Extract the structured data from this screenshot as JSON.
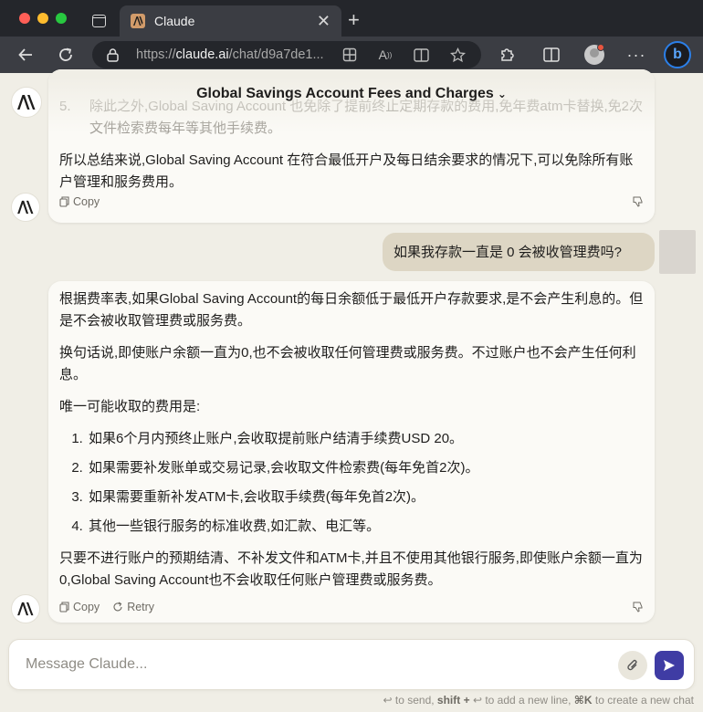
{
  "browser": {
    "tab_title": "Claude",
    "url_domain": "claude.ai",
    "url_prefix": "https://",
    "url_path": "/chat/d9a7de1..."
  },
  "conversation": {
    "title": "Global Savings Account Fees and Charges",
    "prev_assistant": {
      "faded_item_number": "5.",
      "faded_item_text": "除此之外,Global Saving Account 也免除了提前终止定期存款的费用,免年费atm卡替换,免2次文件检索费每年等其他手续费。",
      "summary": "所以总结来说,Global Saving Account 在符合最低开户及每日结余要求的情况下,可以免除所有账户管理和服务费用。",
      "copy_label": "Copy"
    },
    "user_message": "如果我存款一直是 0 会被收管理费吗?",
    "assistant": {
      "paragraphs": [
        "根据费率表,如果Global Saving Account的每日余额低于最低开户存款要求,是不会产生利息的。但是不会被收取管理费或服务费。",
        "换句话说,即使账户余额一直为0,也不会被收取任何管理费或服务费。不过账户也不会产生任何利息。",
        "唯一可能收取的费用是:"
      ],
      "list": [
        "如果6个月内预终止账户,会收取提前账户结清手续费USD 20。",
        "如果需要补发账单或交易记录,会收取文件检索费(每年免首2次)。",
        "如果需要重新补发ATM卡,会收取手续费(每年免首2次)。",
        "其他一些银行服务的标准收费,如汇款、电汇等。"
      ],
      "closing": "只要不进行账户的预期结清、不补发文件和ATM卡,并且不使用其他银行服务,即使账户余额一直为0,Global Saving Account也不会收取任何账户管理费或服务费。",
      "copy_label": "Copy",
      "retry_label": "Retry"
    }
  },
  "composer": {
    "placeholder": "Message Claude...",
    "hint_enter": "to send,",
    "hint_shift": "shift +",
    "hint_newline": "to add a new line,",
    "hint_cmdk": "⌘K",
    "hint_newchat": "to create a new chat"
  },
  "colors": {
    "send_button": "#3f3ca4",
    "user_bubble": "#ddd6c4",
    "page_bg": "#f0eee6"
  }
}
